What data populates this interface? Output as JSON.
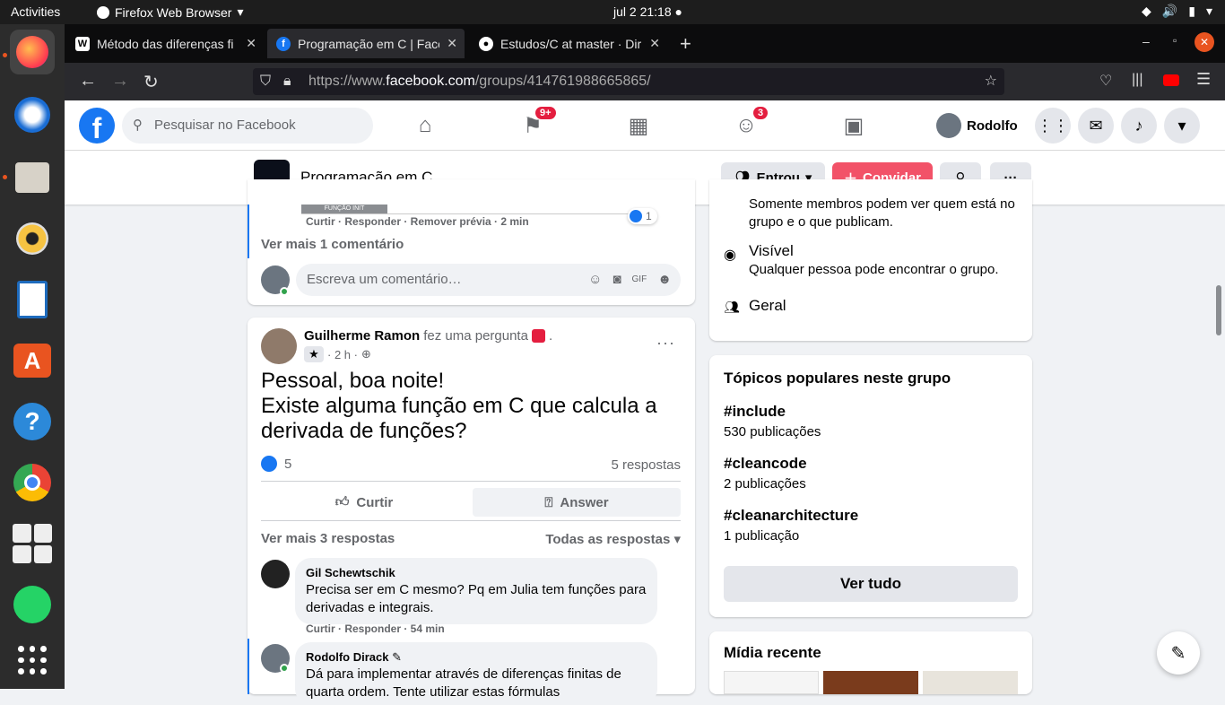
{
  "topbar": {
    "activities": "Activities",
    "app": "Firefox Web Browser",
    "clock": "jul 2  21:18"
  },
  "tabs": [
    {
      "title": "Método das diferenças fi"
    },
    {
      "title": "Programação em C | Face"
    },
    {
      "title": "Estudos/C at master · Dir"
    }
  ],
  "url": {
    "prefix": "https://www.",
    "domain": "facebook.com",
    "path": "/groups/414761988665865/"
  },
  "fb": {
    "search_placeholder": "Pesquisar no Facebook",
    "watch_badge": "9+",
    "groups_badge": "3",
    "user": "Rodolfo"
  },
  "group": {
    "name": "Programação em C",
    "joined": "Entrou",
    "invite": "Convidar",
    "thumb_text": "FUNÇÃO INIT"
  },
  "post1": {
    "actions": "Curtir · Responder · Remover prévia · 2 min",
    "reactions": "1",
    "more_comments": "Ver mais 1 comentário",
    "comment_placeholder": "Escreva um comentário…"
  },
  "post2": {
    "author": "Guilherme Ramon",
    "verb": "fez uma pergunta",
    "time": "· 2 h ·",
    "line1": "Pessoal, boa noite!",
    "line2": "Existe alguma função em C que calcula a",
    "line3": "derivada de funções?",
    "likes": "5",
    "answers": "5 respostas",
    "like_btn": "Curtir",
    "answer_btn": "Answer",
    "more": "Ver mais 3 respostas",
    "all": "Todas as respostas",
    "c1": {
      "name": "Gil Schewtschik",
      "text1": "Precisa ser em C mesmo? Pq em Julia tem funções para",
      "text2": "derivadas e integrais.",
      "actions": "Curtir · Responder · 54 min"
    },
    "c2": {
      "name": "Rodolfo Dirack",
      "text1": "Dá para implementar através de diferenças finitas de",
      "text2": "quarta ordem. Tente utilizar estas fórmulas"
    }
  },
  "about": {
    "partial1": "Somente membros podem ver quem está no",
    "partial2": "grupo e o que publicam.",
    "visible": "Visível",
    "visible_desc": "Qualquer pessoa pode encontrar o grupo.",
    "general": "Geral"
  },
  "topics": {
    "title": "Tópicos populares neste grupo",
    "items": [
      {
        "tag": "#include",
        "count": "530 publicações"
      },
      {
        "tag": "#cleancode",
        "count": "2 publicações"
      },
      {
        "tag": "#cleanarchitecture",
        "count": "1 publicação"
      }
    ],
    "see_all": "Ver tudo"
  },
  "media": {
    "title": "Mídia recente"
  }
}
